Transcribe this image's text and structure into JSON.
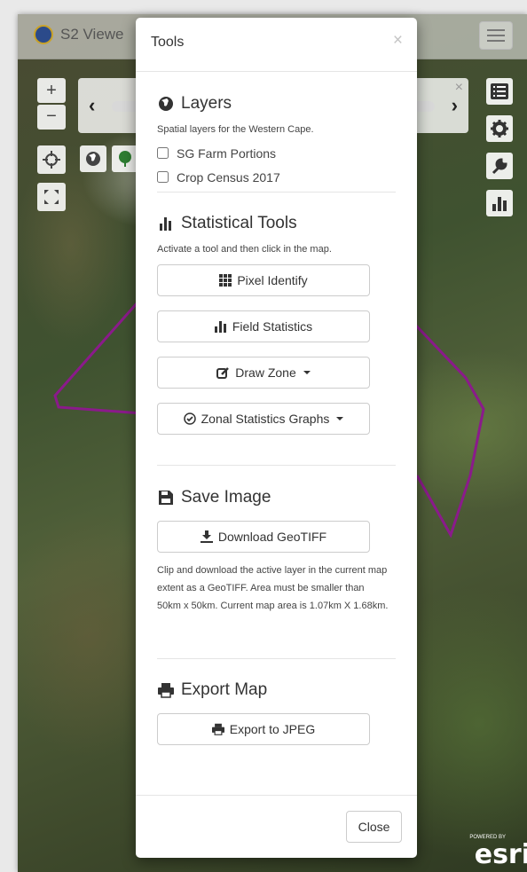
{
  "app": {
    "title": "S2 Viewe"
  },
  "map": {
    "zoom_in": "+",
    "zoom_out": "−",
    "attribution": "esri",
    "attribution_powered": "POWERED BY"
  },
  "modal": {
    "title": "Tools",
    "close_x": "×",
    "layers": {
      "heading": "Layers",
      "description": "Spatial layers for the Western Cape.",
      "checkboxes": [
        {
          "label": "SG Farm Portions",
          "checked": false
        },
        {
          "label": "Crop Census 2017",
          "checked": false
        }
      ]
    },
    "statistical_tools": {
      "heading": "Statistical Tools",
      "description": "Activate a tool and then click in the map.",
      "buttons": {
        "pixel_identify": "Pixel Identify",
        "field_statistics": "Field Statistics",
        "draw_zone": "Draw Zone",
        "zonal_statistics": "Zonal Statistics Graphs"
      }
    },
    "save_image": {
      "heading": "Save Image",
      "button": "Download GeoTIFF",
      "description": "Clip and download the active layer in the current map extent as a GeoTIFF. Area must be smaller than 50km x 50km. Current map area is 1.07km X 1.68km."
    },
    "export_map": {
      "heading": "Export Map",
      "button": "Export to JPEG"
    },
    "footer": {
      "close_label": "Close"
    }
  },
  "icons": {
    "globe": "globe-icon",
    "bar_chart": "bar-chart-icon",
    "save": "save-icon",
    "print": "print-icon",
    "grid": "grid-icon",
    "edit": "edit-icon",
    "check_circle": "check-circle-icon",
    "download": "download-icon",
    "list": "list-icon",
    "gear": "gear-icon",
    "wrench": "wrench-icon",
    "crosshair": "crosshair-icon",
    "expand": "expand-icon"
  },
  "colors": {
    "polygon": "#8b1a8b",
    "modal_bg": "#ffffff",
    "text": "#333333"
  }
}
